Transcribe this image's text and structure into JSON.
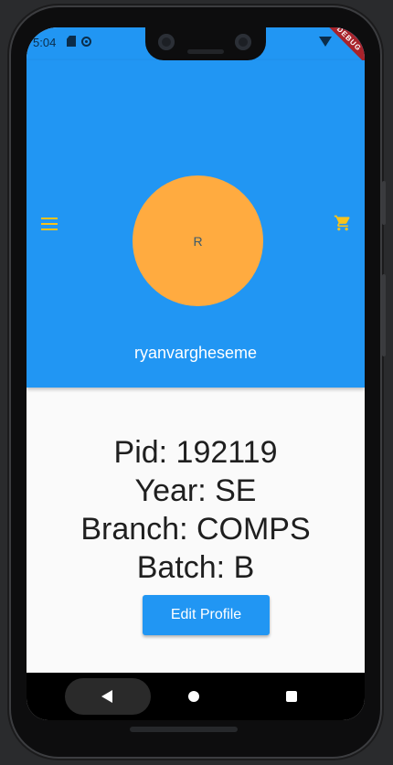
{
  "status_bar": {
    "time": "5:04",
    "debug_label": "DEBUG"
  },
  "header": {
    "avatar_initial": "R",
    "username": "ryanvargheseme"
  },
  "profile": {
    "pid": "Pid: 192119",
    "year": "Year: SE",
    "branch": "Branch: COMPS",
    "batch": "Batch: B"
  },
  "actions": {
    "edit_profile_label": "Edit Profile"
  },
  "icons": {
    "menu": "menu-icon",
    "cart": "shopping-cart-icon",
    "back": "back-icon",
    "home": "home-icon",
    "recents": "recents-icon"
  },
  "colors": {
    "primary": "#2196f3",
    "avatar": "#ffab40",
    "icon_accent": "#f7c31b",
    "background": "#fafafa"
  }
}
